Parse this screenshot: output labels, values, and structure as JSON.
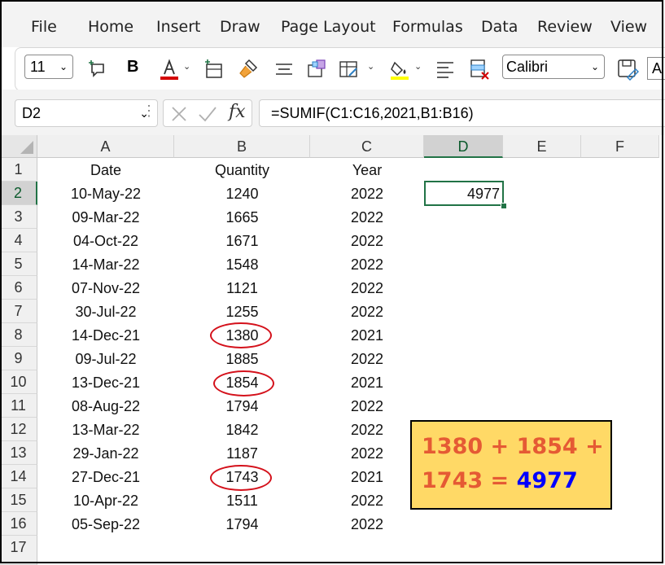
{
  "menu": [
    "File",
    "Home",
    "Insert",
    "Draw",
    "Page Layout",
    "Formulas",
    "Data",
    "Review",
    "View"
  ],
  "ribbon": {
    "font_size": "11",
    "font_name": "Calibri",
    "bold_label": "B",
    "font_color": "#d40000",
    "fill_color": "#ffff00",
    "cut_letter": "A"
  },
  "formula_bar": {
    "name_box": "D2",
    "fx_label": "fx",
    "formula": "=SUMIF(C1:C16,2021,B1:B16)"
  },
  "columns": [
    "A",
    "B",
    "C",
    "D",
    "E",
    "F"
  ],
  "rows": [
    "1",
    "2",
    "3",
    "4",
    "5",
    "6",
    "7",
    "8",
    "9",
    "10",
    "11",
    "12",
    "13",
    "14",
    "15",
    "16",
    "17"
  ],
  "headers": {
    "date": "Date",
    "quantity": "Quantity",
    "year": "Year"
  },
  "table": [
    {
      "date": "10-May-22",
      "qty": "1240",
      "year": "2022"
    },
    {
      "date": "09-Mar-22",
      "qty": "1665",
      "year": "2022"
    },
    {
      "date": "04-Oct-22",
      "qty": "1671",
      "year": "2022"
    },
    {
      "date": "14-Mar-22",
      "qty": "1548",
      "year": "2022"
    },
    {
      "date": "07-Nov-22",
      "qty": "1121",
      "year": "2022"
    },
    {
      "date": "30-Jul-22",
      "qty": "1255",
      "year": "2022"
    },
    {
      "date": "14-Dec-21",
      "qty": "1380",
      "year": "2021"
    },
    {
      "date": "09-Jul-22",
      "qty": "1885",
      "year": "2022"
    },
    {
      "date": "13-Dec-21",
      "qty": "1854",
      "year": "2021"
    },
    {
      "date": "08-Aug-22",
      "qty": "1794",
      "year": "2022"
    },
    {
      "date": "13-Mar-22",
      "qty": "1842",
      "year": "2022"
    },
    {
      "date": "29-Jan-22",
      "qty": "1187",
      "year": "2022"
    },
    {
      "date": "27-Dec-21",
      "qty": "1743",
      "year": "2021"
    },
    {
      "date": "10-Apr-22",
      "qty": "1511",
      "year": "2022"
    },
    {
      "date": "05-Sep-22",
      "qty": "1794",
      "year": "2022"
    }
  ],
  "result": "4977",
  "callout": {
    "line1": "1380 + 1854 +",
    "line2_prefix": "1743 = ",
    "line2_result": "4977"
  },
  "colors": {
    "accent_green": "#217346",
    "circle_red": "#d4111b",
    "callout_bg": "#ffd966",
    "callout_text": "#e55a34",
    "callout_result": "#0000ff"
  }
}
